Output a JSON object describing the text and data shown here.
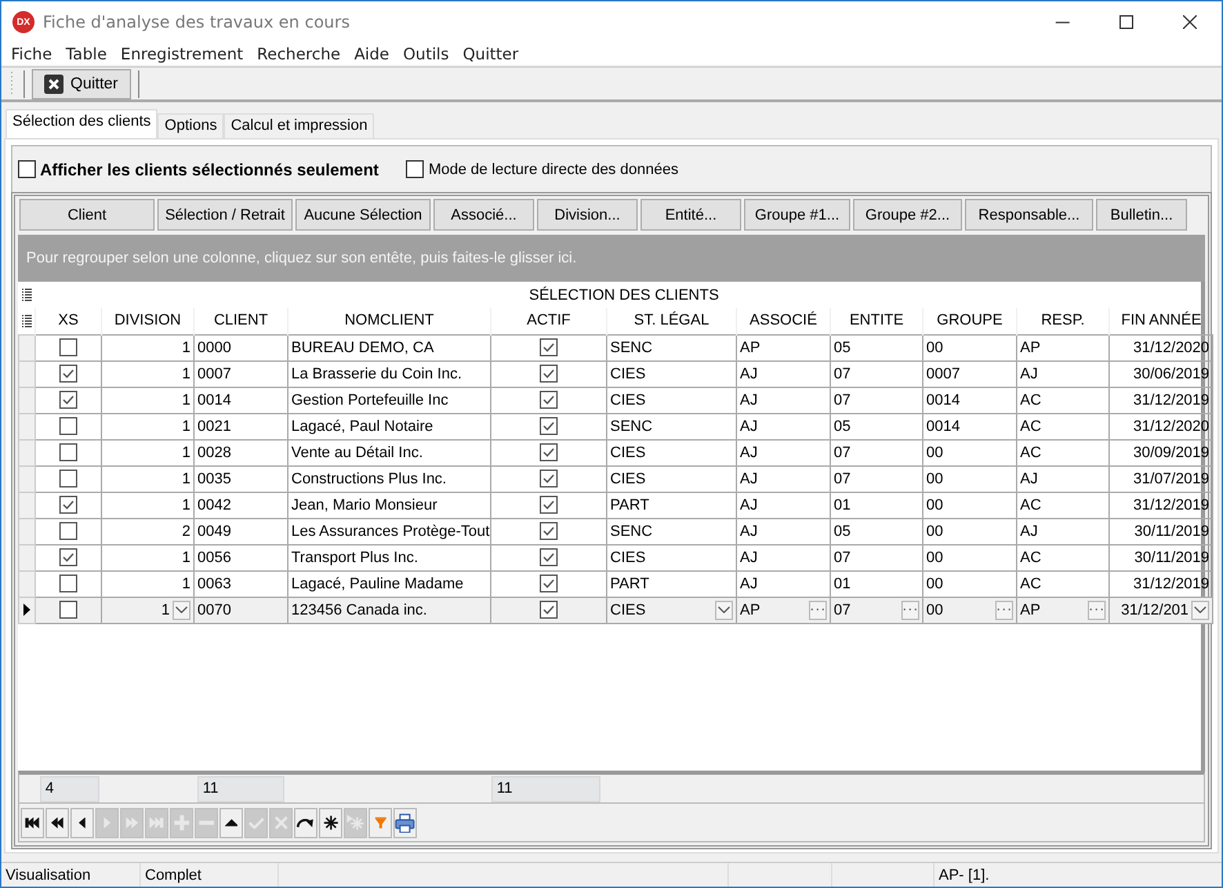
{
  "window": {
    "title": "Fiche d'analyse des travaux en cours",
    "icon_label": "DX"
  },
  "menu": [
    "Fiche",
    "Table",
    "Enregistrement",
    "Recherche",
    "Aide",
    "Outils",
    "Quitter"
  ],
  "toolbar": [
    {
      "label": "Quitter"
    }
  ],
  "tabs": [
    {
      "label": "Sélection des clients",
      "selected": true
    },
    {
      "label": "Options",
      "selected": false
    },
    {
      "label": "Calcul et impression",
      "selected": false
    }
  ],
  "options": [
    {
      "label": "Afficher les clients sélectionnés seulement",
      "checked": false
    },
    {
      "label": "Mode de lecture directe des données",
      "checked": false
    }
  ],
  "actions": [
    "Client",
    "Sélection / Retrait",
    "Aucune Sélection",
    "Associé...",
    "Division...",
    "Entité...",
    "Groupe #1...",
    "Groupe #2...",
    "Responsable...",
    "Bulletin..."
  ],
  "group_panel": {
    "hint": "Pour regrouper selon une colonne, cliquez sur son entête, puis faites-le glisser ici."
  },
  "grid": {
    "band": "SÉLECTION DES CLIENTS",
    "columns": [
      {
        "title": "XS",
        "kind": "check",
        "footer": "4"
      },
      {
        "title": "DIVISION",
        "kind": "number-dropdown"
      },
      {
        "title": "CLIENT",
        "kind": "text",
        "footer": "11"
      },
      {
        "title": "NOMCLIENT",
        "kind": "text"
      },
      {
        "title": "ACTIF",
        "kind": "check",
        "footer": "11"
      },
      {
        "title": "ST. LÉGAL",
        "kind": "text-dropdown"
      },
      {
        "title": "ASSOCIÉ",
        "kind": "text-ellipsis"
      },
      {
        "title": "ENTITE",
        "kind": "text-ellipsis"
      },
      {
        "title": "GROUPE",
        "kind": "text-ellipsis"
      },
      {
        "title": "RESP.",
        "kind": "text-ellipsis"
      },
      {
        "title": "FIN ANNÉE",
        "kind": "number-dropdown"
      }
    ],
    "rows": [
      {
        "current": false,
        "values": [
          false,
          "1",
          "0000",
          "BUREAU DEMO, CA",
          true,
          "SENC",
          "AP",
          "05",
          "00",
          "AP",
          "31/12/2020"
        ]
      },
      {
        "current": false,
        "values": [
          true,
          "1",
          "0007",
          "La Brasserie du Coin Inc.",
          true,
          "CIES",
          "AJ",
          "07",
          "0007",
          "AJ",
          "30/06/2019"
        ]
      },
      {
        "current": false,
        "values": [
          true,
          "1",
          "0014",
          "Gestion Portefeuille Inc",
          true,
          "CIES",
          "AJ",
          "07",
          "0014",
          "AC",
          "31/12/2019"
        ]
      },
      {
        "current": false,
        "values": [
          false,
          "1",
          "0021",
          "Lagacé, Paul Notaire",
          true,
          "SENC",
          "AJ",
          "05",
          "0014",
          "AC",
          "31/12/2020"
        ]
      },
      {
        "current": false,
        "values": [
          false,
          "1",
          "0028",
          "Vente au Détail Inc.",
          true,
          "CIES",
          "AJ",
          "07",
          "00",
          "AC",
          "30/09/2019"
        ]
      },
      {
        "current": false,
        "values": [
          false,
          "1",
          "0035",
          "Constructions Plus  Inc.",
          true,
          "CIES",
          "AJ",
          "07",
          "00",
          "AJ",
          "31/07/2019"
        ]
      },
      {
        "current": false,
        "values": [
          true,
          "1",
          "0042",
          "Jean, Mario Monsieur",
          true,
          "PART",
          "AJ",
          "01",
          "00",
          "AC",
          "31/12/2019"
        ]
      },
      {
        "current": false,
        "values": [
          false,
          "2",
          "0049",
          "Les Assurances Protège-Tout",
          true,
          "SENC",
          "AJ",
          "05",
          "00",
          "AJ",
          "30/11/2019"
        ]
      },
      {
        "current": false,
        "values": [
          true,
          "1",
          "0056",
          "Transport Plus Inc.",
          true,
          "CIES",
          "AJ",
          "07",
          "00",
          "AC",
          "30/11/2019"
        ]
      },
      {
        "current": false,
        "values": [
          false,
          "1",
          "0063",
          "Lagacé, Pauline Madame",
          true,
          "PART",
          "AJ",
          "01",
          "00",
          "AC",
          "31/12/2019"
        ]
      },
      {
        "current": true,
        "values": [
          false,
          "1",
          "0070",
          "123456 Canada inc.",
          true,
          "CIES",
          "AP",
          "07",
          "00",
          "AP",
          "31/12/201"
        ]
      }
    ]
  },
  "navigator": [
    {
      "kind": "first",
      "disabled": false
    },
    {
      "kind": "prior-page",
      "disabled": false
    },
    {
      "kind": "prior",
      "disabled": false
    },
    {
      "kind": "next",
      "disabled": true
    },
    {
      "kind": "next-page",
      "disabled": true
    },
    {
      "kind": "last",
      "disabled": true
    },
    {
      "kind": "insert",
      "disabled": true
    },
    {
      "kind": "delete",
      "disabled": true
    },
    {
      "kind": "edit",
      "disabled": false
    },
    {
      "kind": "post",
      "disabled": true
    },
    {
      "kind": "cancel",
      "disabled": true
    },
    {
      "kind": "refresh",
      "disabled": false
    },
    {
      "kind": "bookmark",
      "disabled": false
    },
    {
      "kind": "goto",
      "disabled": true
    },
    {
      "kind": "filter",
      "disabled": false
    },
    {
      "kind": "print",
      "disabled": false
    }
  ],
  "status_bar": {
    "mode": "Visualisation",
    "state": "Complet",
    "user": "AP- [1]."
  }
}
